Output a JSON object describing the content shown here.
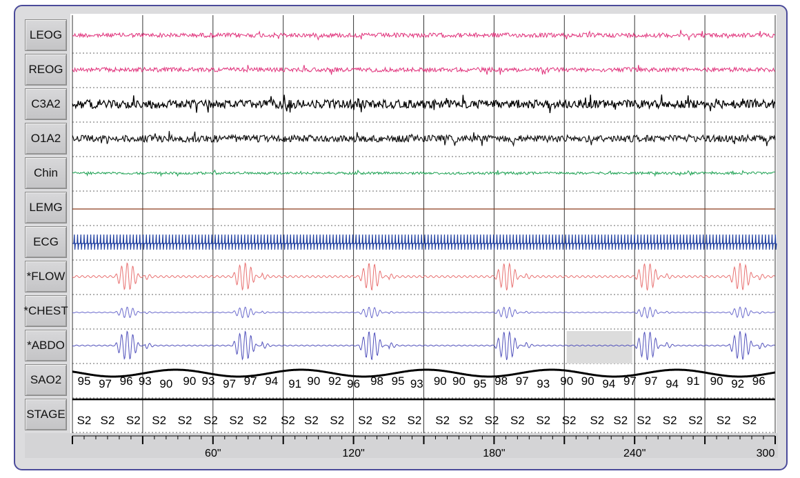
{
  "channels": [
    {
      "label": "LEOG"
    },
    {
      "label": "REOG"
    },
    {
      "label": "C3A2"
    },
    {
      "label": "O1A2"
    },
    {
      "label": "Chin"
    },
    {
      "label": "LEMG"
    },
    {
      "label": "ECG"
    },
    {
      "label": "*FLOW"
    },
    {
      "label": "*CHEST"
    },
    {
      "label": "*ABDO"
    },
    {
      "label": "SAO2"
    },
    {
      "label": "STAGE"
    }
  ],
  "colors": {
    "LEOG": "#e0307a",
    "REOG": "#e0307a",
    "C3A2": "#000000",
    "O1A2": "#111111",
    "Chin": "#1aa050",
    "LEMG": "#8b3a1a",
    "ECG": "#1f3fa0",
    "FLOW": "#e87070",
    "CHEST": "#6a6acc",
    "ABDO": "#5050bb",
    "SAO2": "#000000"
  },
  "sao2_values": [
    {
      "t": 5,
      "v": "95"
    },
    {
      "t": 14,
      "v": "97"
    },
    {
      "t": 23,
      "v": "96"
    },
    {
      "t": 31,
      "v": "93"
    },
    {
      "t": 40,
      "v": "90"
    },
    {
      "t": 50,
      "v": "90"
    },
    {
      "t": 58,
      "v": "93"
    },
    {
      "t": 67,
      "v": "97"
    },
    {
      "t": 76,
      "v": "97"
    },
    {
      "t": 85,
      "v": "94"
    },
    {
      "t": 95,
      "v": "91"
    },
    {
      "t": 103,
      "v": "90"
    },
    {
      "t": 112,
      "v": "92"
    },
    {
      "t": 120,
      "v": "96"
    },
    {
      "t": 130,
      "v": "98"
    },
    {
      "t": 139,
      "v": "95"
    },
    {
      "t": 147,
      "v": "93"
    },
    {
      "t": 157,
      "v": "90"
    },
    {
      "t": 165,
      "v": "90"
    },
    {
      "t": 174,
      "v": "95"
    },
    {
      "t": 183,
      "v": "98"
    },
    {
      "t": 192,
      "v": "97"
    },
    {
      "t": 201,
      "v": "93"
    },
    {
      "t": 211,
      "v": "90"
    },
    {
      "t": 220,
      "v": "90"
    },
    {
      "t": 229,
      "v": "94"
    },
    {
      "t": 238,
      "v": "97"
    },
    {
      "t": 247,
      "v": "97"
    },
    {
      "t": 256,
      "v": "94"
    },
    {
      "t": 265,
      "v": "91"
    },
    {
      "t": 275,
      "v": "90"
    },
    {
      "t": 284,
      "v": "92"
    },
    {
      "t": 293,
      "v": "96"
    }
  ],
  "stage_values": [
    {
      "t": 5,
      "v": "S2"
    },
    {
      "t": 15,
      "v": "S2"
    },
    {
      "t": 26,
      "v": "S2"
    },
    {
      "t": 37,
      "v": "S2"
    },
    {
      "t": 48,
      "v": "S2"
    },
    {
      "t": 59,
      "v": "S2"
    },
    {
      "t": 70,
      "v": "S2"
    },
    {
      "t": 80,
      "v": "S2"
    },
    {
      "t": 92,
      "v": "S2"
    },
    {
      "t": 102,
      "v": "S2"
    },
    {
      "t": 113,
      "v": "S2"
    },
    {
      "t": 125,
      "v": "S2"
    },
    {
      "t": 135,
      "v": "S2"
    },
    {
      "t": 146,
      "v": "S2"
    },
    {
      "t": 158,
      "v": "S2"
    },
    {
      "t": 168,
      "v": "S2"
    },
    {
      "t": 179,
      "v": "S2"
    },
    {
      "t": 190,
      "v": "S2"
    },
    {
      "t": 201,
      "v": "S2"
    },
    {
      "t": 212,
      "v": "S2"
    },
    {
      "t": 224,
      "v": "S2"
    },
    {
      "t": 234,
      "v": "S2"
    },
    {
      "t": 244,
      "v": "S2"
    },
    {
      "t": 255,
      "v": "S2"
    },
    {
      "t": 266,
      "v": "S2"
    },
    {
      "t": 278,
      "v": "S2"
    },
    {
      "t": 289,
      "v": "S2"
    }
  ],
  "time_axis": {
    "ticks": [
      {
        "t": 60,
        "label": "60\""
      },
      {
        "t": 120,
        "label": "120\""
      },
      {
        "t": 180,
        "label": "180\""
      },
      {
        "t": 240,
        "label": "240\""
      },
      {
        "t": 300,
        "label": "300"
      }
    ],
    "range_seconds": [
      0,
      300
    ],
    "epoch_seconds": 30
  },
  "apnea_cycle_starts": [
    18,
    68,
    122,
    180,
    240,
    280
  ]
}
